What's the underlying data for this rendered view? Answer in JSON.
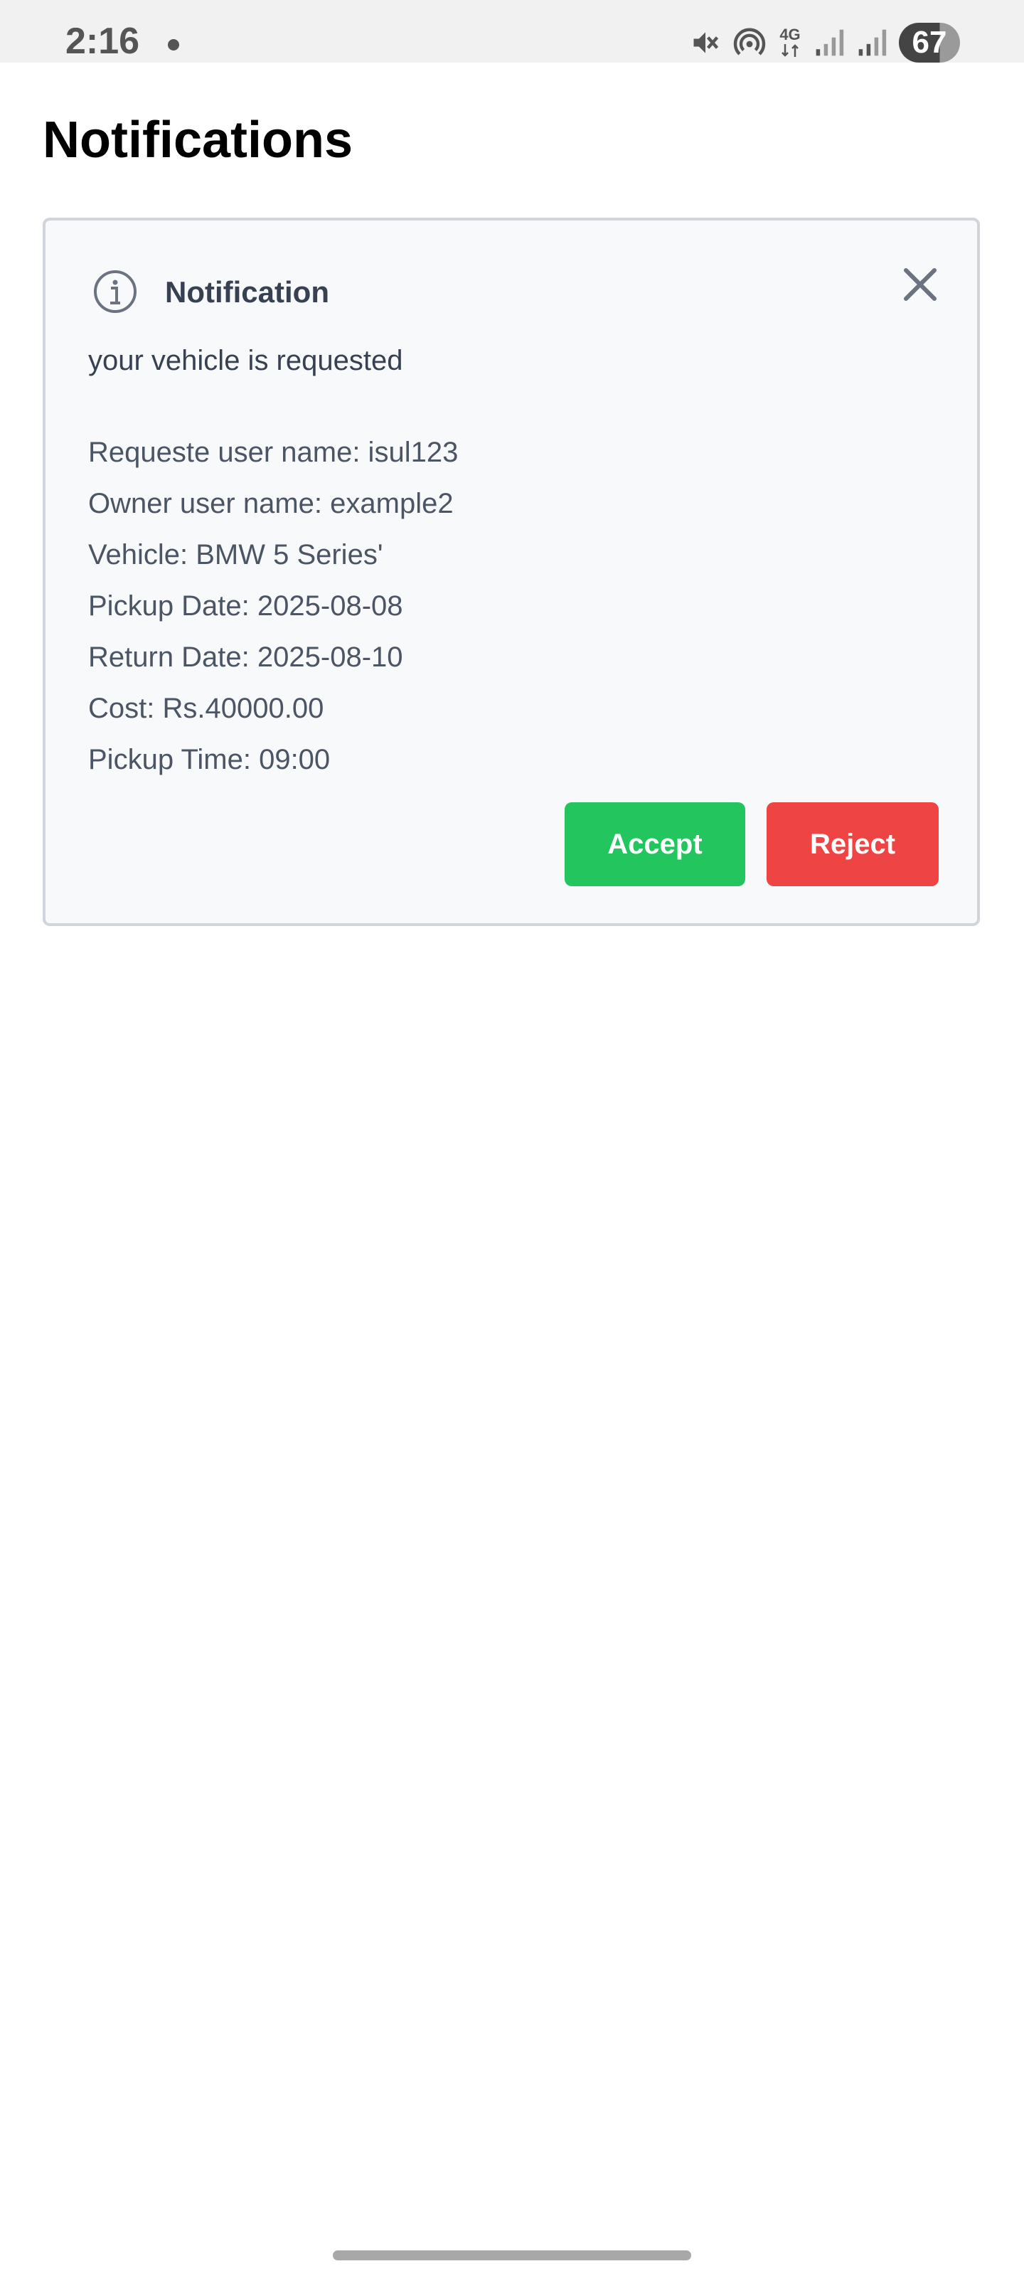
{
  "status_bar": {
    "time": "2:16",
    "network": "4G",
    "battery": "67",
    "icons": [
      "mute-icon",
      "hotspot-icon",
      "network-4g-icon",
      "signal-icon",
      "signal-icon",
      "battery-icon"
    ]
  },
  "page": {
    "title": "Notifications"
  },
  "notification": {
    "icon": "info-icon",
    "heading": "Notification",
    "message": "your vehicle is requested",
    "details": [
      "Requeste user name: isul123",
      "Owner user name: example2",
      "Vehicle: BMW 5 Series'",
      "Pickup Date: 2025-08-08",
      "Return Date: 2025-08-10",
      "Cost: Rs.40000.00",
      "Pickup Time: 09:00"
    ],
    "accept_label": "Accept",
    "reject_label": "Reject",
    "colors": {
      "accept": "#22c55e",
      "reject": "#ef4444",
      "card_background": "#f8f9fb",
      "card_border": "#d1d5db"
    }
  }
}
